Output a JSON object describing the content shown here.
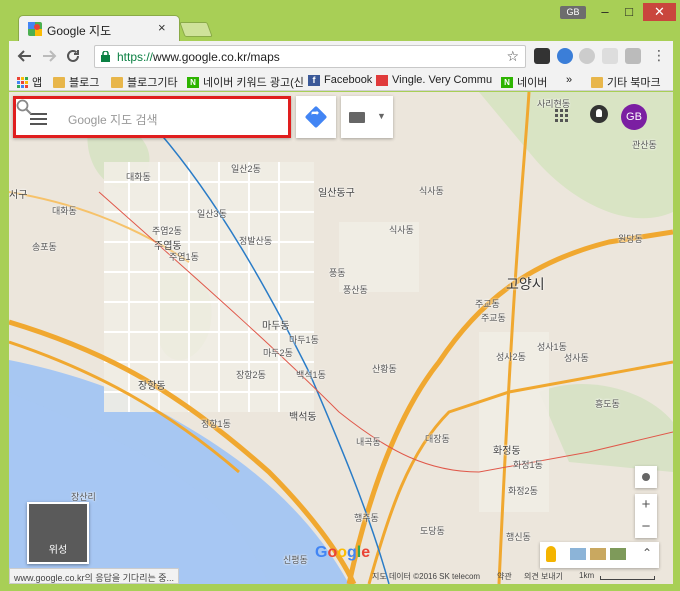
{
  "browser": {
    "tab_title": "Google 지도",
    "tab_close": "×",
    "profile": "GB",
    "window_buttons": {
      "minimize": "–",
      "maximize": "□",
      "close": "✕"
    },
    "url_scheme": "https://",
    "url_rest": "www.google.co.kr/maps",
    "menu": "⋮"
  },
  "bookmarks": [
    {
      "label": "앱",
      "icon": "apps-grid"
    },
    {
      "label": "블로그",
      "icon": "folder"
    },
    {
      "label": "블로그기타",
      "icon": "folder"
    },
    {
      "label": "네이버 키워드 광고(신",
      "icon": "naver"
    },
    {
      "label": "Facebook",
      "icon": "facebook"
    },
    {
      "label": "Vingle. Very Commu",
      "icon": "vingle"
    },
    {
      "label": "네이버",
      "icon": "naver"
    },
    {
      "label": "»",
      "icon": ""
    },
    {
      "label": "기타 북마크",
      "icon": "folder"
    }
  ],
  "maps": {
    "search_placeholder": "Google 지도 검색",
    "avatar": "GB",
    "satellite_label": "위성",
    "zoom_in": "+",
    "zoom_out": "−",
    "collapse": "⌃",
    "status_text": "www.google.co.kr의 응답을 기다리는 중...",
    "attribution": "지도 데이터 ©2016 SK telecom",
    "terms": "약관",
    "feedback": "의견 보내기",
    "scale": "1km",
    "google_logo": "Google",
    "map_labels": [
      {
        "text": "일산2동"
      },
      {
        "text": "대화동"
      },
      {
        "text": "일산3동"
      },
      {
        "text": "일산동구"
      },
      {
        "text": "식사동"
      },
      {
        "text": "서구"
      },
      {
        "text": "대화동"
      },
      {
        "text": "주엽2동"
      },
      {
        "text": "주엽동"
      },
      {
        "text": "주엽1동"
      },
      {
        "text": "정발산동"
      },
      {
        "text": "식사동"
      },
      {
        "text": "송포동"
      },
      {
        "text": "풍동"
      },
      {
        "text": "풍산동"
      },
      {
        "text": "고양시"
      },
      {
        "text": "주교동"
      },
      {
        "text": "주교동"
      },
      {
        "text": "마두동"
      },
      {
        "text": "마두1동"
      },
      {
        "text": "마두2동"
      },
      {
        "text": "성사1동"
      },
      {
        "text": "성사2동"
      },
      {
        "text": "성사동"
      },
      {
        "text": "장항동"
      },
      {
        "text": "장항2동"
      },
      {
        "text": "백석1동"
      },
      {
        "text": "산황동"
      },
      {
        "text": "백석동"
      },
      {
        "text": "정항1동"
      },
      {
        "text": "내곡동"
      },
      {
        "text": "대장동"
      },
      {
        "text": "화정동"
      },
      {
        "text": "화정1동"
      },
      {
        "text": "화정2동"
      },
      {
        "text": "행주동"
      },
      {
        "text": "도당동"
      },
      {
        "text": "행신동"
      },
      {
        "text": "신평동"
      },
      {
        "text": "사리현동"
      },
      {
        "text": "관산동"
      },
      {
        "text": "원당동"
      },
      {
        "text": "흥도동"
      },
      {
        "text": "장산리"
      }
    ]
  },
  "colors": {
    "frame": "#a8cf56",
    "highlight": "#e01e1e",
    "map_bg": "#ece6dc",
    "water": "#a7c7f2",
    "highway": "#f0a830",
    "avatar": "#7b1fa2"
  }
}
